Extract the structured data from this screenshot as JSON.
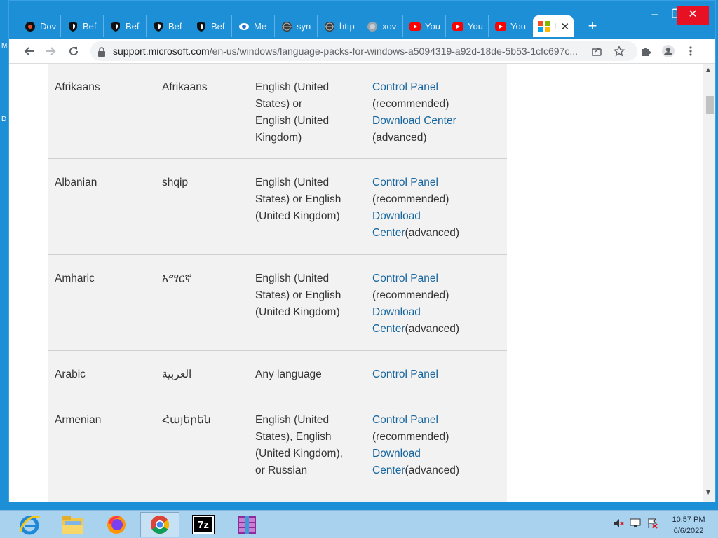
{
  "desktop": {
    "left_letters": [
      "M",
      "D"
    ]
  },
  "browser": {
    "tabs": [
      {
        "label": "Dov",
        "icon": "blackhole-icon",
        "active": false
      },
      {
        "label": "Bef",
        "icon": "shield-icon",
        "active": false
      },
      {
        "label": "Bef",
        "icon": "shield-icon",
        "active": false
      },
      {
        "label": "Bef",
        "icon": "shield-icon",
        "active": false
      },
      {
        "label": "Bef",
        "icon": "shield-icon",
        "active": false
      },
      {
        "label": "Me",
        "icon": "medium-icon",
        "active": false
      },
      {
        "label": "syn",
        "icon": "globe-icon",
        "active": false
      },
      {
        "label": "http",
        "icon": "globe-icon",
        "active": false
      },
      {
        "label": "xov",
        "icon": "grey-globe-icon",
        "active": false
      },
      {
        "label": "You",
        "icon": "youtube-icon",
        "active": false
      },
      {
        "label": "You",
        "icon": "youtube-icon",
        "active": false
      },
      {
        "label": "You",
        "icon": "youtube-icon",
        "active": false
      },
      {
        "label": "I",
        "icon": "microsoft-logo-icon",
        "active": true
      }
    ],
    "new_tab": "+",
    "window_buttons": {
      "minimize": "–",
      "maximize": "❐",
      "close": "✕"
    },
    "address": {
      "host": "support.microsoft.com",
      "path": "/en-us/windows/language-packs-for-windows-a5094319-a92d-18de-5b53-1cfc697c..."
    }
  },
  "table": {
    "rows": [
      {
        "language": "Afrikaans",
        "native": "Afrikaans",
        "base": "English (United States) or English (United Kingdom)",
        "link1": "Control Panel",
        "link1_suffix": " (recommended)",
        "link2": "Download Center",
        "link2_suffix": " (advanced)"
      },
      {
        "language": "Albanian",
        "native": "shqip",
        "base": "English (United States) or English (United Kingdom)",
        "link1": "Control Panel",
        "link1_suffix": " (recommended)",
        "link2": "Download Center",
        "link2_suffix": "(advanced)"
      },
      {
        "language": "Amharic",
        "native": "አማርኛ",
        "base": "English (United States) or English (United Kingdom)",
        "link1": "Control Panel",
        "link1_suffix": " (recommended)",
        "link2": "Download Center",
        "link2_suffix": "(advanced)"
      },
      {
        "language": "Arabic",
        "native": "العربية",
        "base": "Any language",
        "link1": "Control Panel"
      },
      {
        "language": "Armenian",
        "native": "Հայերեն",
        "base": "English (United States), English (United Kingdom), or Russian",
        "link1": "Control Panel",
        "link1_suffix": " (recommended)",
        "link2": "Download Center",
        "link2_suffix": "(advanced)"
      }
    ]
  },
  "taskbar": {
    "apps": [
      "internet-explorer-icon",
      "file-explorer-icon",
      "firefox-icon",
      "chrome-icon",
      "7zip-icon",
      "winrar-icon"
    ],
    "active_app": "chrome-icon",
    "seven_zip_label": "7z",
    "clock_time": "10:57 PM",
    "clock_date": "6/6/2022"
  }
}
